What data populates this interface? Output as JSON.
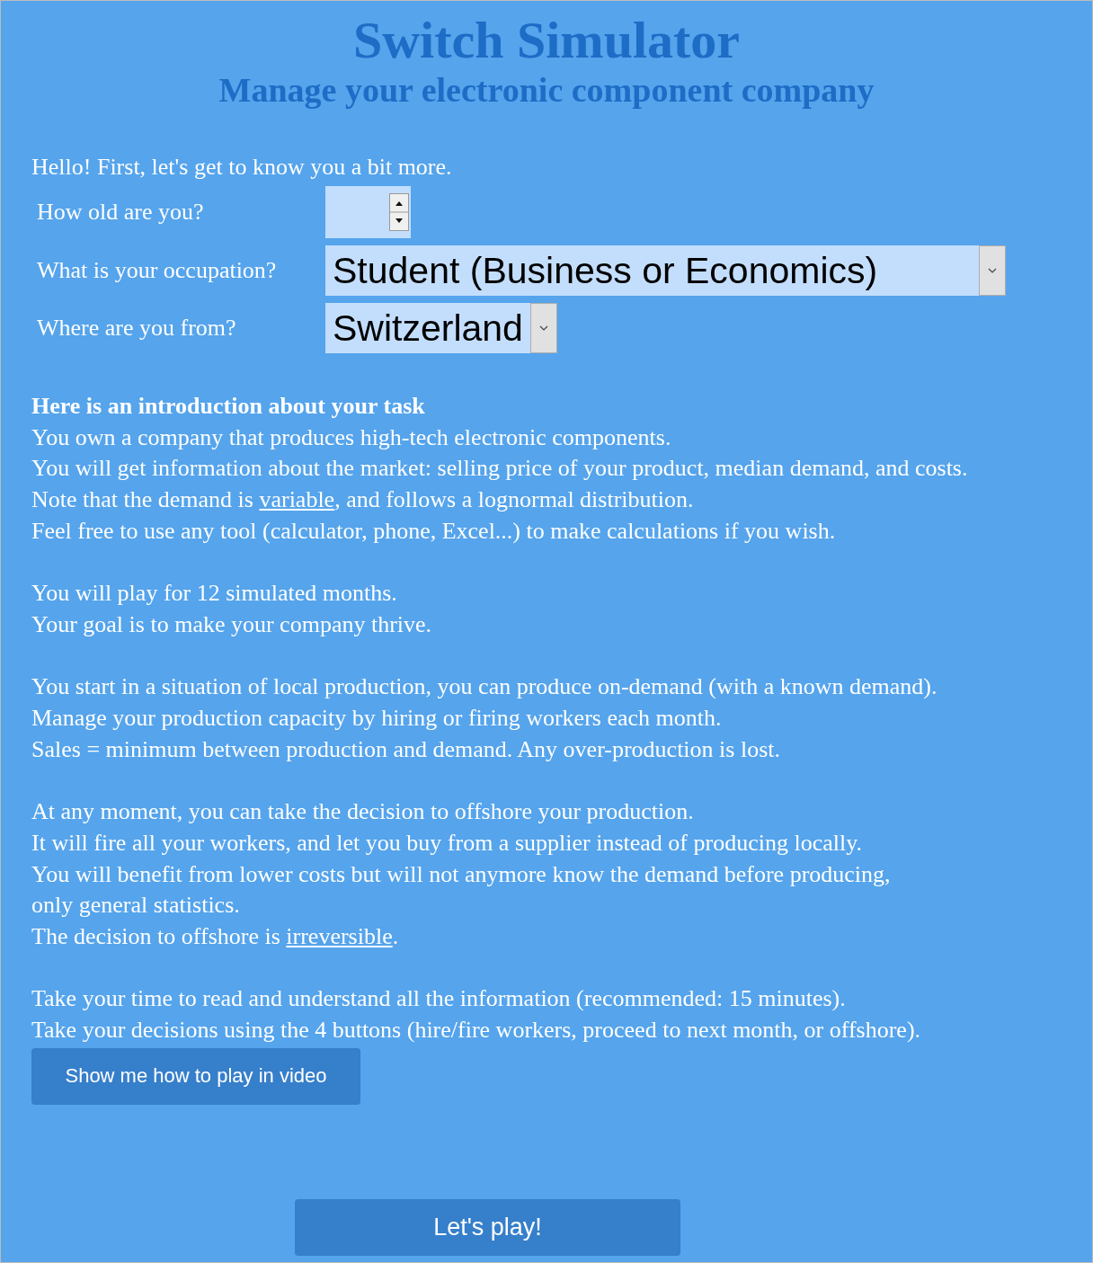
{
  "title": "Switch Simulator",
  "subtitle": "Manage your electronic component company",
  "greeting": "Hello! First, let's get to know you a bit more.",
  "form": [
    {
      "label": "How old are you?",
      "kind": "number"
    },
    {
      "label": "What is your occupation?",
      "kind": "select",
      "value": "Student (Business or Economics)"
    },
    {
      "label": "Where are you from?",
      "kind": "select",
      "value": "Switzerland"
    }
  ],
  "intro": {
    "heading": "Here is an introduction about your task",
    "paragraphs": [
      [
        [
          "You own a company that produces high-tech electronic components."
        ],
        [
          "You will get information about the market: selling price of your product, median demand, and costs."
        ],
        [
          "Note that the demand is ",
          {
            "link": "variable"
          },
          ", and follows a lognormal distribution."
        ],
        [
          "Feel free to use any tool (calculator, phone, Excel...) to make calculations if you wish."
        ]
      ],
      [
        [
          "You will play for 12 simulated months."
        ],
        [
          "Your goal is to make your company thrive."
        ]
      ],
      [
        [
          "You start in a situation of local production, you can produce on-demand (with a known demand)."
        ],
        [
          "Manage your production capacity by hiring or firing workers each month."
        ],
        [
          "Sales = minimum between production and demand. Any over-production is lost."
        ]
      ],
      [
        [
          "At any moment, you can take the decision to offshore your production."
        ],
        [
          "It will fire all your workers, and let you buy from a supplier instead of producing locally."
        ],
        [
          "You will benefit from lower costs but will not anymore know the demand before producing,"
        ],
        [
          "only general statistics."
        ],
        [
          "The decision to offshore is ",
          {
            "link": "irreversible"
          },
          "."
        ]
      ],
      [
        [
          "Take your time to read and understand all the information (recommended: 15 minutes)."
        ],
        [
          "Take your decisions using the 4 buttons (hire/fire workers, proceed to next month, or offshore)."
        ]
      ]
    ]
  },
  "video_button": "Show me how to play in video",
  "play_button": "Let's play!"
}
